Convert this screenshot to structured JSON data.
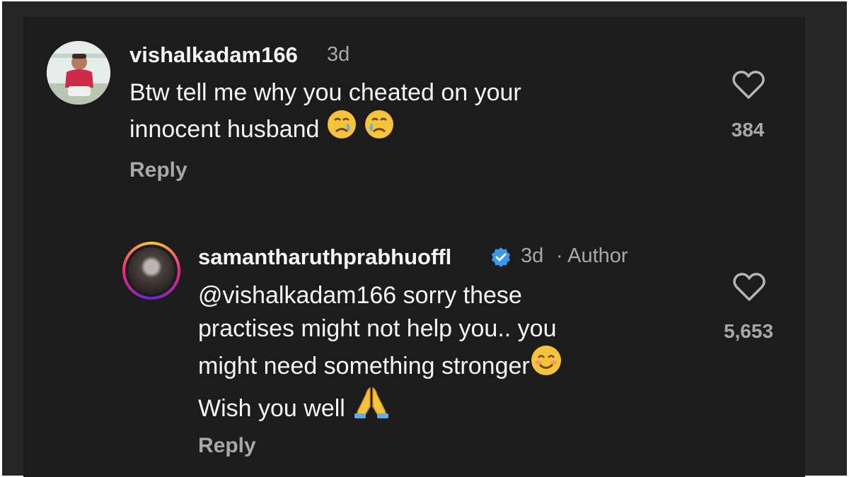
{
  "comments": [
    {
      "username": "vishalkadam166",
      "time": "3d",
      "text_line1": "Btw tell me why you cheated on your",
      "text_line2": "innocent husband",
      "likes": "384",
      "reply_label": "Reply",
      "avatar_icon": "user-photo",
      "emojis": [
        "crying-face-icon",
        "crying-face-icon"
      ]
    },
    {
      "username": "samantharuthprabhuoffl",
      "time": "3d",
      "author_label": "· Author",
      "text_line1": "@vishalkadam166 sorry these",
      "text_line2": "practises might not help you.. you",
      "text_line3": "might need something stronger",
      "text_line4": "Wish you well",
      "likes": "5,653",
      "reply_label": "Reply",
      "verified": true,
      "emojis": [
        "smiling-face-icon",
        "folded-hands-icon"
      ]
    }
  ],
  "colors": {
    "background": "#1c1c1c",
    "text_primary": "#f5f5f5",
    "text_secondary": "#a8a8a8",
    "verified_blue": "#3897f0"
  }
}
